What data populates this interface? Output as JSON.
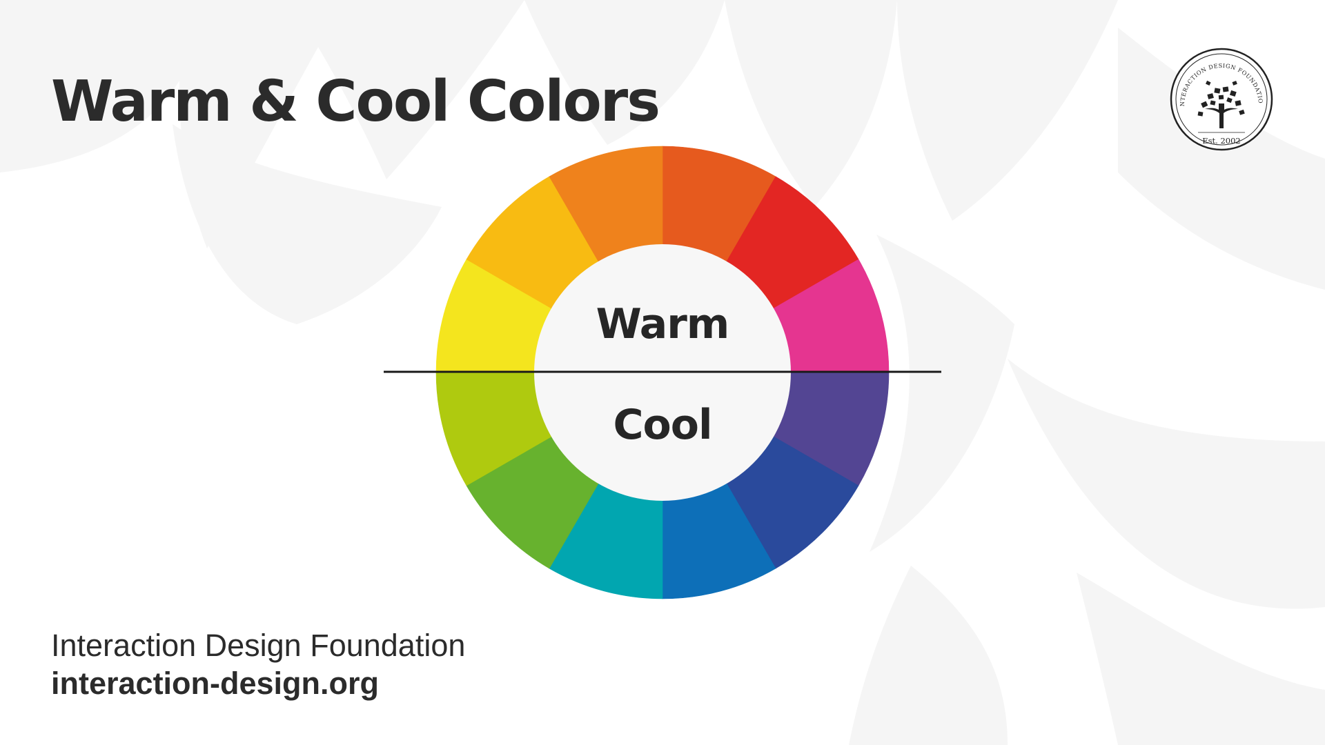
{
  "slide": {
    "title": "Warm & Cool Colors"
  },
  "wheel": {
    "labels": {
      "warm": "Warm",
      "cool": "Cool"
    },
    "segments": [
      {
        "group": "warm",
        "color": "#E65A1E"
      },
      {
        "group": "warm",
        "color": "#E32623"
      },
      {
        "group": "warm",
        "color": "#E53590"
      },
      {
        "group": "cool",
        "color": "#534593"
      },
      {
        "group": "cool",
        "color": "#2A4A9C"
      },
      {
        "group": "cool",
        "color": "#0D6FB8"
      },
      {
        "group": "cool",
        "color": "#01A6B0"
      },
      {
        "group": "cool",
        "color": "#67B22E"
      },
      {
        "group": "cool",
        "color": "#AFCA0F"
      },
      {
        "group": "warm",
        "color": "#F4E51E"
      },
      {
        "group": "warm",
        "color": "#F8BB12"
      },
      {
        "group": "warm",
        "color": "#EF821C"
      }
    ]
  },
  "logo": {
    "arc_text": "INTERACTION DESIGN FOUNDATION",
    "established": "Est. 2002"
  },
  "footer": {
    "org_name": "Interaction Design Foundation",
    "url": "interaction-design.org"
  },
  "colors": {
    "text": "#2b2b2b",
    "background": "#ffffff",
    "watermark": "#f4f4f4",
    "divider": "#1a1a1a"
  }
}
